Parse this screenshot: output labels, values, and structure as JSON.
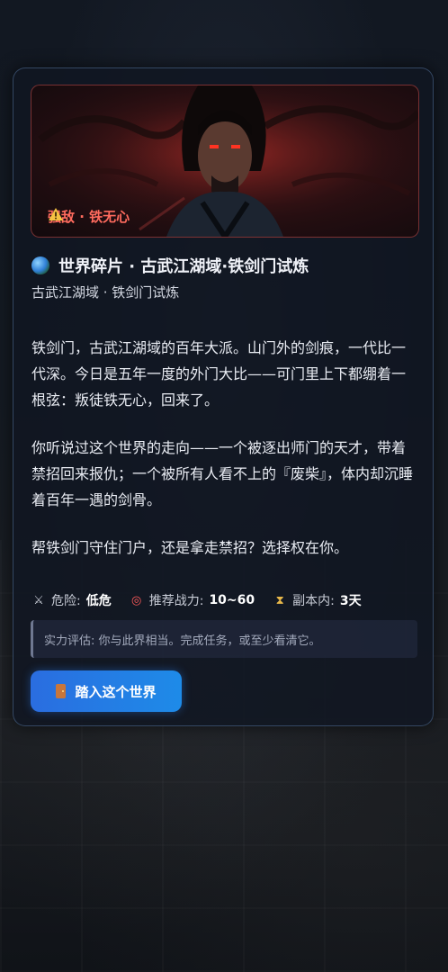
{
  "hero": {
    "badge_label": "强敌 · 铁无心",
    "badge_icon": "warning-icon"
  },
  "header": {
    "title_icon": "globe-icon",
    "title": "世界碎片 · 古武江湖域·铁剑门试炼",
    "subtitle": "古武江湖域 · 铁剑门试炼"
  },
  "story": {
    "paragraphs": [
      "铁剑门，古武江湖域的百年大派。山门外的剑痕，一代比一代深。今日是五年一度的外门大比——可门里上下都绷着一根弦：叛徒铁无心，回来了。",
      "你听说过这个世界的走向——一个被逐出师门的天才，带着禁招回来报仇；一个被所有人看不上的『废柴』，体内却沉睡着百年一遇的剑骨。",
      "帮铁剑门守住门户，还是拿走禁招？选择权在你。"
    ]
  },
  "stats": {
    "danger_label": "危险:",
    "danger_value": "低危",
    "power_label": "推荐战力:",
    "power_value": "10~60",
    "duration_label": "副本内:",
    "duration_value": "3天"
  },
  "assessment": "实力评估: 你与此界相当。完成任务，或至少看清它。",
  "enter_button": {
    "label": "踏入这个世界",
    "icon": "door-icon"
  },
  "colors": {
    "accent": "#2a6de0",
    "danger": "#ff6b5e",
    "card_border": "#6082b4"
  }
}
